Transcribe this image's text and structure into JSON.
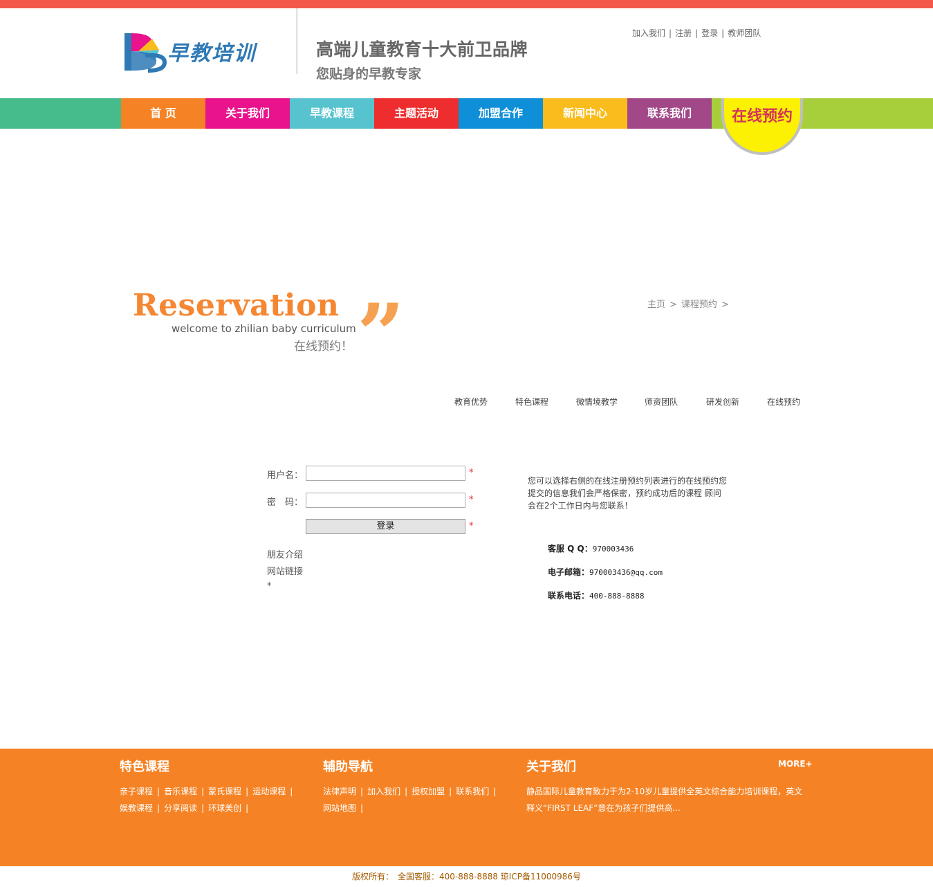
{
  "header": {
    "logo_text": "早教培训",
    "slogan_main": "高端儿童教育十大前卫品牌",
    "slogan_sub": "您贴身的早教专家",
    "top_links": [
      "加入我们",
      "注册",
      "登录",
      "教师团队"
    ]
  },
  "nav": {
    "items": [
      {
        "label": "首  页",
        "color": "#f58325"
      },
      {
        "label": "关于我们",
        "color": "#e8138d"
      },
      {
        "label": "早教课程",
        "color": "#57c3cf"
      },
      {
        "label": "主题活动",
        "color": "#ee2e2e"
      },
      {
        "label": "加盟合作",
        "color": "#0f8fd8"
      },
      {
        "label": "新闻中心",
        "color": "#f9bc1c"
      },
      {
        "label": "联系我们",
        "color": "#a24888"
      }
    ],
    "badge": "在线预约"
  },
  "banner": {
    "title": "Reservation",
    "subtitle": "welcome to zhilian baby curriculum",
    "cn_title": "在线预约！"
  },
  "breadcrumb": {
    "items": [
      "主页",
      "课程预约"
    ],
    "sep": ">"
  },
  "subnav": [
    "教育优势",
    "特色课程",
    "微情境教学",
    "师资团队",
    "研发创新",
    "在线预约"
  ],
  "form": {
    "username_label": "用户名：",
    "username_value": "",
    "password_label": "密　码：",
    "password_value": "",
    "login_button": "登录",
    "required_mark": "*",
    "links": [
      "朋友介绍",
      "网站链接",
      "*"
    ]
  },
  "info": {
    "text": "您可以选择右侧的在线注册预约列表进行的在线预约您提交的信息我们会严格保密，预约成功后的课程 顾问会在2个工作日内与您联系！",
    "qq_label": "客服 Q Q：",
    "qq": "970003436",
    "email_label": "电子邮箱：",
    "email": "970003436@qq.com",
    "phone_label": "联系电话：",
    "phone": "400-888-8888"
  },
  "footer": {
    "col1_title": "特色课程",
    "col1_links": [
      "亲子课程",
      "音乐课程",
      "蒙氏课程",
      "运动课程",
      "娱教课程",
      "分享阅读",
      "环球美创"
    ],
    "col2_title": "辅助导航",
    "col2_links": [
      "法律声明",
      "加入我们",
      "授权加盟",
      "联系我们",
      "网站地图"
    ],
    "col3_title": "关于我们",
    "col3_text": "静品国际儿童教育致力于为2-10岁儿童提供全英文综合能力培训课程，英文释义“FIRST LEAF”意在为孩子们提供高...",
    "more": "MORE+",
    "copyright": "版权所有：　全国客服：400-888-8888 琼ICP备11000986号"
  },
  "colors": {
    "accent": "#f58325",
    "topbar": "#f2574c",
    "nav_left": "#46bb8b",
    "nav_right": "#a7cf3b",
    "badge": "#fbf100"
  }
}
